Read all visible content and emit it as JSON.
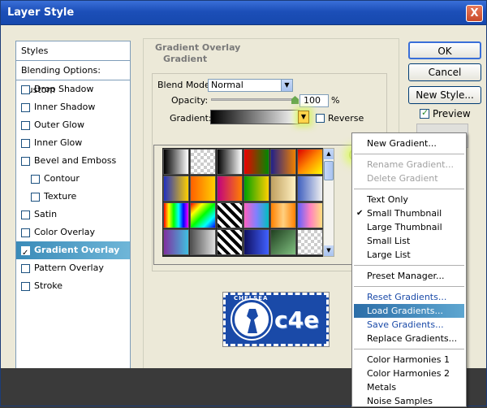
{
  "window": {
    "title": "Layer Style",
    "close_label": "X"
  },
  "styles_panel": {
    "header": "Styles",
    "blending_options": "Blending Options: Custom",
    "items": [
      {
        "label": "Drop Shadow",
        "checked": false,
        "indent": false,
        "active": false
      },
      {
        "label": "Inner Shadow",
        "checked": false,
        "indent": false,
        "active": false
      },
      {
        "label": "Outer Glow",
        "checked": false,
        "indent": false,
        "active": false
      },
      {
        "label": "Inner Glow",
        "checked": false,
        "indent": false,
        "active": false
      },
      {
        "label": "Bevel and Emboss",
        "checked": false,
        "indent": false,
        "active": false
      },
      {
        "label": "Contour",
        "checked": false,
        "indent": true,
        "active": false
      },
      {
        "label": "Texture",
        "checked": false,
        "indent": true,
        "active": false
      },
      {
        "label": "Satin",
        "checked": false,
        "indent": false,
        "active": false
      },
      {
        "label": "Color Overlay",
        "checked": false,
        "indent": false,
        "active": false
      },
      {
        "label": "Gradient Overlay",
        "checked": true,
        "indent": false,
        "active": true
      },
      {
        "label": "Pattern Overlay",
        "checked": false,
        "indent": false,
        "active": false
      },
      {
        "label": "Stroke",
        "checked": false,
        "indent": false,
        "active": false
      }
    ]
  },
  "gradient_overlay": {
    "group_title": "Gradient Overlay",
    "sub_title": "Gradient",
    "blend_mode_label": "Blend Mode:",
    "blend_mode_value": "Normal",
    "opacity_label": "Opacity:",
    "opacity_value": "100",
    "opacity_unit": "%",
    "opacity_level": 1.0,
    "gradient_label": "Gradient:",
    "reverse_label": "Reverse",
    "reverse_checked": false
  },
  "gradient_swatches": [
    "linear-gradient(90deg,#000,#fff)",
    "repeating-conic-gradient(#ccc 0 25%,#fff 0 50%) 0 0/8px 8px",
    "linear-gradient(90deg,#000,#fff)",
    "linear-gradient(90deg,#e00,#080)",
    "linear-gradient(90deg,#20208a,#f08000)",
    "linear-gradient(135deg,#d00,#f80,#ff0)",
    "linear-gradient(90deg,#2030c0,#ffd000)",
    "linear-gradient(90deg,#ff6000,#ffd000)",
    "linear-gradient(90deg,#c00080,#ff8000)",
    "linear-gradient(90deg,#00a000,#ffd000)",
    "linear-gradient(90deg,#c0a060,#fff0c0)",
    "linear-gradient(90deg,#4060c0,#f0f0f0)",
    "linear-gradient(90deg,#f00,#ff0,#0f0,#0ff,#00f,#f0f)",
    "linear-gradient(135deg,#f00,#ff0,#0f0,#0ff,#00f)",
    "repeating-linear-gradient(45deg,#000 0 4px,#fff 4px 8px)",
    "linear-gradient(90deg,#ff60c0,#8080ff,#00c0c0)",
    "linear-gradient(90deg,#ff8000,#ffd080,#ff8000)",
    "linear-gradient(90deg,#6060ff,#ff80c0,#ffe080)",
    "linear-gradient(90deg,#8030a0,#40c0e0)",
    "linear-gradient(90deg,#505050,#e0e0e0)",
    "repeating-linear-gradient(45deg,#000 0 4px,#fff 4px 8px)",
    "linear-gradient(90deg,#101060,#4060ff)",
    "linear-gradient(135deg,#204020,#80c080)",
    "repeating-conic-gradient(#ccc 0 25%,#fff 0 50%) 0 0/8px 8px"
  ],
  "context_menu": {
    "groups": [
      [
        {
          "label": "New Gradient...",
          "state": "normal"
        }
      ],
      [
        {
          "label": "Rename Gradient...",
          "state": "disabled"
        },
        {
          "label": "Delete Gradient",
          "state": "disabled"
        }
      ],
      [
        {
          "label": "Text Only",
          "state": "normal"
        },
        {
          "label": "Small Thumbnail",
          "state": "checked"
        },
        {
          "label": "Large Thumbnail",
          "state": "normal"
        },
        {
          "label": "Small List",
          "state": "normal"
        },
        {
          "label": "Large List",
          "state": "normal"
        }
      ],
      [
        {
          "label": "Preset Manager...",
          "state": "normal"
        }
      ],
      [
        {
          "label": "Reset Gradients...",
          "state": "blue"
        },
        {
          "label": "Load Gradients...",
          "state": "highlighted"
        },
        {
          "label": "Save Gradients...",
          "state": "blue"
        },
        {
          "label": "Replace Gradients...",
          "state": "normal"
        }
      ],
      [
        {
          "label": "Color Harmonies 1",
          "state": "normal"
        },
        {
          "label": "Color Harmonies 2",
          "state": "normal"
        },
        {
          "label": "Metals",
          "state": "normal"
        },
        {
          "label": "Noise Samples",
          "state": "normal"
        }
      ]
    ]
  },
  "buttons": {
    "ok": "OK",
    "cancel": "Cancel",
    "new_style": "New Style...",
    "preview_label": "Preview",
    "preview_checked": true
  },
  "badge": {
    "crest_text": "CHELSEA",
    "logo_text": "c4e"
  }
}
